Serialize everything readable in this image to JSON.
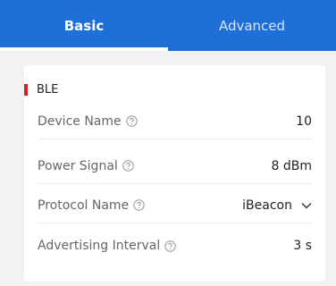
{
  "tabs": [
    {
      "label": "Basic",
      "active": true
    },
    {
      "label": "Advanced",
      "active": false
    }
  ],
  "section": {
    "title": "BLE",
    "accent_color": "#d81e2c"
  },
  "rows": [
    {
      "label": "Device Name",
      "value": "10"
    },
    {
      "label": "Power Signal",
      "value": "8 dBm"
    },
    {
      "label": "Protocol Name",
      "value": "iBeacon"
    },
    {
      "label": "Advertising Interval",
      "value": "3 s"
    }
  ],
  "colors": {
    "tabbar": "#1f6fd8",
    "background": "#f2f2f2"
  },
  "icons": {
    "help": "question-circle-icon",
    "dropdown": "chevron-down-icon"
  }
}
